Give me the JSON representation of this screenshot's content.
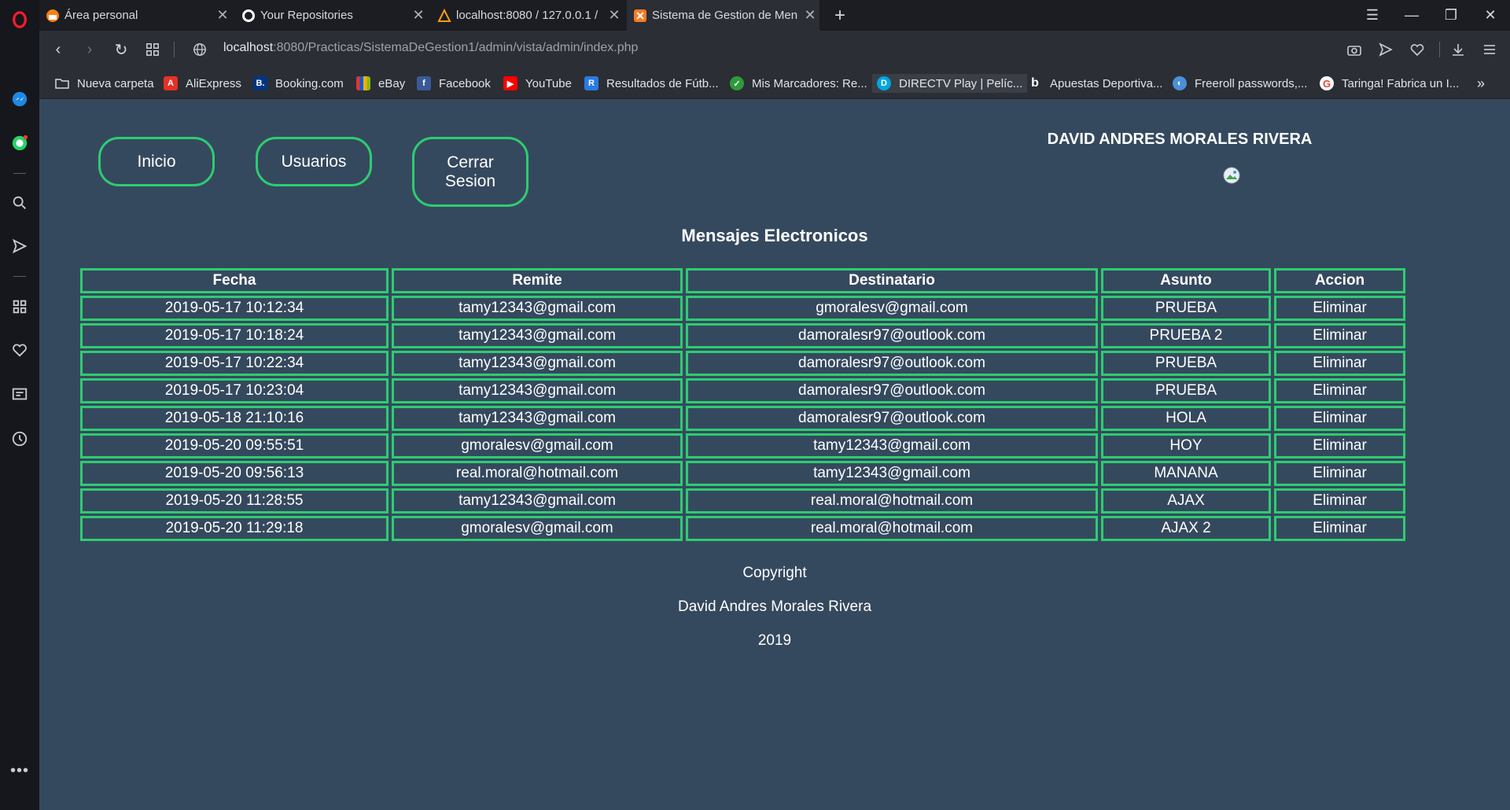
{
  "browser": {
    "tabs": [
      {
        "title": "Área personal",
        "active": false
      },
      {
        "title": "Your Repositories",
        "active": false
      },
      {
        "title": "localhost:8080 / 127.0.0.1 /",
        "active": false
      },
      {
        "title": "Sistema de Gestion de Men",
        "active": true
      }
    ],
    "url_host": "localhost",
    "url_rest": ":8080/Practicas/SistemaDeGestion1/admin/vista/admin/index.php",
    "bookmarks": [
      {
        "label": "Nueva carpeta",
        "icon": "folder-icon"
      },
      {
        "label": "AliExpress",
        "icon": "aliexpress-icon",
        "color": "#e43225"
      },
      {
        "label": "Booking.com",
        "icon": "booking-icon",
        "color": "#003580"
      },
      {
        "label": "eBay",
        "icon": "ebay-icon"
      },
      {
        "label": "Facebook",
        "icon": "facebook-icon",
        "color": "#3b5998"
      },
      {
        "label": "YouTube",
        "icon": "youtube-icon",
        "color": "#ff0000"
      },
      {
        "label": "Resultados de Fútb...",
        "icon": "resultados-icon",
        "color": "#2a7ae2"
      },
      {
        "label": "Mis Marcadores: Re...",
        "icon": "marcadores-icon",
        "color": "#2e9b3a"
      },
      {
        "label": "DIRECTV Play | Pelíc...",
        "icon": "directv-icon",
        "color": "#00a6e0"
      },
      {
        "label": "Apuestas Deportiva...",
        "icon": "apuestas-icon",
        "color": "#ffffff"
      },
      {
        "label": "Freeroll passwords,...",
        "icon": "freeroll-icon",
        "color": "#4a90d9"
      },
      {
        "label": "Taringa! Fabrica un I...",
        "icon": "google-icon",
        "color": "#ffffff"
      }
    ]
  },
  "nav": {
    "inicio": "Inicio",
    "usuarios": "Usuarios",
    "cerrar_line1": "Cerrar",
    "cerrar_line2": "Sesion"
  },
  "user": {
    "name": "DAVID ANDRES MORALES RIVERA"
  },
  "messages": {
    "title": "Mensajes Electronicos",
    "headers": [
      "Fecha",
      "Remite",
      "Destinatario",
      "Asunto",
      "Accion"
    ],
    "rows": [
      [
        "2019-05-17 10:12:34",
        "tamy12343@gmail.com",
        "gmoralesv@gmail.com",
        "PRUEBA",
        "Eliminar"
      ],
      [
        "2019-05-17 10:18:24",
        "tamy12343@gmail.com",
        "damoralesr97@outlook.com",
        "PRUEBA 2",
        "Eliminar"
      ],
      [
        "2019-05-17 10:22:34",
        "tamy12343@gmail.com",
        "damoralesr97@outlook.com",
        "PRUEBA",
        "Eliminar"
      ],
      [
        "2019-05-17 10:23:04",
        "tamy12343@gmail.com",
        "damoralesr97@outlook.com",
        "PRUEBA",
        "Eliminar"
      ],
      [
        "2019-05-18 21:10:16",
        "tamy12343@gmail.com",
        "damoralesr97@outlook.com",
        "HOLA",
        "Eliminar"
      ],
      [
        "2019-05-20 09:55:51",
        "gmoralesv@gmail.com",
        "tamy12343@gmail.com",
        "HOY",
        "Eliminar"
      ],
      [
        "2019-05-20 09:56:13",
        "real.moral@hotmail.com",
        "tamy12343@gmail.com",
        "MANANA",
        "Eliminar"
      ],
      [
        "2019-05-20 11:28:55",
        "tamy12343@gmail.com",
        "real.moral@hotmail.com",
        "AJAX",
        "Eliminar"
      ],
      [
        "2019-05-20 11:29:18",
        "gmoralesv@gmail.com",
        "real.moral@hotmail.com",
        "AJAX 2",
        "Eliminar"
      ]
    ]
  },
  "footer": {
    "line1": "Copyright",
    "line2": "David Andres Morales Rivera",
    "line3": "2019"
  },
  "colors": {
    "page_bg": "#35495e",
    "accent_green": "#2ecc71"
  }
}
